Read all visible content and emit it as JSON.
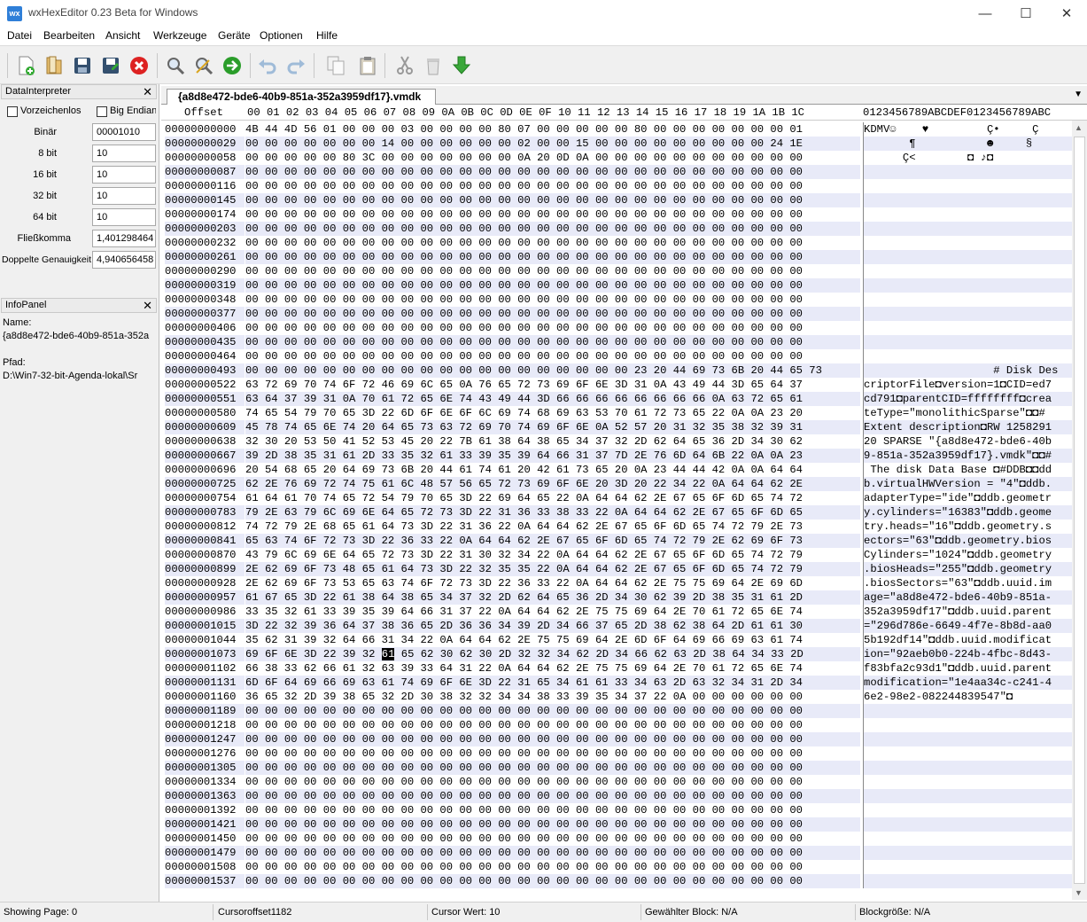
{
  "window": {
    "title": "wxHexEditor 0.23 Beta for Windows",
    "app_icon_text": "wx",
    "minimize": "—",
    "maximize": "☐",
    "close": "✕"
  },
  "menu": [
    "Datei",
    "Bearbeiten",
    "Ansicht",
    "Werkzeuge",
    "Geräte",
    "Optionen",
    "Hilfe"
  ],
  "toolbar": {
    "icons": [
      "new-file-icon",
      "open-file-icon",
      "save-icon",
      "save-as-icon",
      "close-file-icon",
      "find-icon",
      "find-replace-icon",
      "goto-icon",
      "undo-icon",
      "redo-icon",
      "copy-icon",
      "paste-icon",
      "cut-icon",
      "delete-icon",
      "insert-icon"
    ]
  },
  "datainterpreter": {
    "title": "DataInterpreter",
    "signed_label": "Vorzeichenlos",
    "bigendian_label": "Big Endian",
    "fields": [
      {
        "label": "Binär",
        "value": "00001010"
      },
      {
        "label": "8 bit",
        "value": "10"
      },
      {
        "label": "16 bit",
        "value": "10"
      },
      {
        "label": "32 bit",
        "value": "10"
      },
      {
        "label": "64 bit",
        "value": "10"
      },
      {
        "label": "Fließkomma",
        "value": "1,401298464"
      },
      {
        "label": "Doppelte Genauigkeit",
        "value": "4,940656458"
      }
    ]
  },
  "infopanel": {
    "title": "InfoPanel",
    "name_label": "Name:",
    "name_value": "{a8d8e472-bde6-40b9-851a-352a",
    "path_label": "Pfad:",
    "path_value": "D:\\Win7-32-bit-Agenda-lokal\\Sr"
  },
  "tab": {
    "label": "{a8d8e472-bde6-40b9-851a-352a3959df17}.vmdk"
  },
  "hex": {
    "header_offset": "Offset",
    "header_bytes": "00 01 02 03 04 05 06 07 08 09 0A 0B 0C 0D 0E 0F 10 11 12 13 14 15 16 17 18 19 1A 1B 1C",
    "header_text": "0123456789ABCDEF0123456789ABC",
    "rows": [
      [
        "00000000000",
        "4B 44 4D 56 01 00 00 00 03 00 00 00 00 80 07 00 00 00 00 00 80 00 00 00 00 00 00 00 01",
        "KDMV☺    ♥         Ç•     Ç       ☺"
      ],
      [
        "00000000029",
        "00 00 00 00 00 00 00 14 00 00 00 00 00 00 02 00 00 15 00 00 00 00 00 00 00 00 00 24 1E",
        "       ¶           ☻     §         $▲"
      ],
      [
        "00000000058",
        "00 00 00 00 00 80 3C 00 00 00 00 00 00 00 0A 20 0D 0A 00 00 00 00 00 00 00 00 00 00 00",
        "      Ç<        ◘ ♪◘"
      ],
      [
        "00000000087",
        "00 00 00 00 00 00 00 00 00 00 00 00 00 00 00 00 00 00 00 00 00 00 00 00 00 00 00 00 00",
        ""
      ],
      [
        "00000000116",
        "00 00 00 00 00 00 00 00 00 00 00 00 00 00 00 00 00 00 00 00 00 00 00 00 00 00 00 00 00",
        ""
      ],
      [
        "00000000145",
        "00 00 00 00 00 00 00 00 00 00 00 00 00 00 00 00 00 00 00 00 00 00 00 00 00 00 00 00 00",
        ""
      ],
      [
        "00000000174",
        "00 00 00 00 00 00 00 00 00 00 00 00 00 00 00 00 00 00 00 00 00 00 00 00 00 00 00 00 00",
        ""
      ],
      [
        "00000000203",
        "00 00 00 00 00 00 00 00 00 00 00 00 00 00 00 00 00 00 00 00 00 00 00 00 00 00 00 00 00",
        ""
      ],
      [
        "00000000232",
        "00 00 00 00 00 00 00 00 00 00 00 00 00 00 00 00 00 00 00 00 00 00 00 00 00 00 00 00 00",
        ""
      ],
      [
        "00000000261",
        "00 00 00 00 00 00 00 00 00 00 00 00 00 00 00 00 00 00 00 00 00 00 00 00 00 00 00 00 00",
        ""
      ],
      [
        "00000000290",
        "00 00 00 00 00 00 00 00 00 00 00 00 00 00 00 00 00 00 00 00 00 00 00 00 00 00 00 00 00",
        ""
      ],
      [
        "00000000319",
        "00 00 00 00 00 00 00 00 00 00 00 00 00 00 00 00 00 00 00 00 00 00 00 00 00 00 00 00 00",
        ""
      ],
      [
        "00000000348",
        "00 00 00 00 00 00 00 00 00 00 00 00 00 00 00 00 00 00 00 00 00 00 00 00 00 00 00 00 00",
        ""
      ],
      [
        "00000000377",
        "00 00 00 00 00 00 00 00 00 00 00 00 00 00 00 00 00 00 00 00 00 00 00 00 00 00 00 00 00",
        ""
      ],
      [
        "00000000406",
        "00 00 00 00 00 00 00 00 00 00 00 00 00 00 00 00 00 00 00 00 00 00 00 00 00 00 00 00 00",
        ""
      ],
      [
        "00000000435",
        "00 00 00 00 00 00 00 00 00 00 00 00 00 00 00 00 00 00 00 00 00 00 00 00 00 00 00 00 00",
        ""
      ],
      [
        "00000000464",
        "00 00 00 00 00 00 00 00 00 00 00 00 00 00 00 00 00 00 00 00 00 00 00 00 00 00 00 00 00",
        ""
      ],
      [
        "00000000493",
        "00 00 00 00 00 00 00 00 00 00 00 00 00 00 00 00 00 00 00 00 23 20 44 69 73 6B 20 44 65 73",
        "                    # Disk Des"
      ],
      [
        "00000000522",
        "63 72 69 70 74 6F 72 46 69 6C 65 0A 76 65 72 73 69 6F 6E 3D 31 0A 43 49 44 3D 65 64 37",
        "criptorFile◘version=1◘CID=ed7"
      ],
      [
        "00000000551",
        "63 64 37 39 31 0A 70 61 72 65 6E 74 43 49 44 3D 66 66 66 66 66 66 66 66 0A 63 72 65 61",
        "cd791◘parentCID=ffffffff◘crea"
      ],
      [
        "00000000580",
        "74 65 54 79 70 65 3D 22 6D 6F 6E 6F 6C 69 74 68 69 63 53 70 61 72 73 65 22 0A 0A 23 20",
        "teType=\"monolithicSparse\"◘◘# "
      ],
      [
        "00000000609",
        "45 78 74 65 6E 74 20 64 65 73 63 72 69 70 74 69 6F 6E 0A 52 57 20 31 32 35 38 32 39 31",
        "Extent description◘RW 1258291"
      ],
      [
        "00000000638",
        "32 30 20 53 50 41 52 53 45 20 22 7B 61 38 64 38 65 34 37 32 2D 62 64 65 36 2D 34 30 62",
        "20 SPARSE \"{a8d8e472-bde6-40b"
      ],
      [
        "00000000667",
        "39 2D 38 35 31 61 2D 33 35 32 61 33 39 35 39 64 66 31 37 7D 2E 76 6D 64 6B 22 0A 0A 23",
        "9-851a-352a3959df17}.vmdk\"◘◘#"
      ],
      [
        "00000000696",
        "20 54 68 65 20 64 69 73 6B 20 44 61 74 61 20 42 61 73 65 20 0A 23 44 44 42 0A 0A 64 64",
        " The disk Data Base ◘#DDB◘◘dd"
      ],
      [
        "00000000725",
        "62 2E 76 69 72 74 75 61 6C 48 57 56 65 72 73 69 6F 6E 20 3D 20 22 34 22 0A 64 64 62 2E",
        "b.virtualHWVersion = \"4\"◘ddb."
      ],
      [
        "00000000754",
        "61 64 61 70 74 65 72 54 79 70 65 3D 22 69 64 65 22 0A 64 64 62 2E 67 65 6F 6D 65 74 72",
        "adapterType=\"ide\"◘ddb.geometr"
      ],
      [
        "00000000783",
        "79 2E 63 79 6C 69 6E 64 65 72 73 3D 22 31 36 33 38 33 22 0A 64 64 62 2E 67 65 6F 6D 65",
        "y.cylinders=\"16383\"◘ddb.geome"
      ],
      [
        "00000000812",
        "74 72 79 2E 68 65 61 64 73 3D 22 31 36 22 0A 64 64 62 2E 67 65 6F 6D 65 74 72 79 2E 73",
        "try.heads=\"16\"◘ddb.geometry.s"
      ],
      [
        "00000000841",
        "65 63 74 6F 72 73 3D 22 36 33 22 0A 64 64 62 2E 67 65 6F 6D 65 74 72 79 2E 62 69 6F 73",
        "ectors=\"63\"◘ddb.geometry.bios"
      ],
      [
        "00000000870",
        "43 79 6C 69 6E 64 65 72 73 3D 22 31 30 32 34 22 0A 64 64 62 2E 67 65 6F 6D 65 74 72 79",
        "Cylinders=\"1024\"◘ddb.geometry"
      ],
      [
        "00000000899",
        "2E 62 69 6F 73 48 65 61 64 73 3D 22 32 35 35 22 0A 64 64 62 2E 67 65 6F 6D 65 74 72 79",
        ".biosHeads=\"255\"◘ddb.geometry"
      ],
      [
        "00000000928",
        "2E 62 69 6F 73 53 65 63 74 6F 72 73 3D 22 36 33 22 0A 64 64 62 2E 75 75 69 64 2E 69 6D",
        ".biosSectors=\"63\"◘ddb.uuid.im"
      ],
      [
        "00000000957",
        "61 67 65 3D 22 61 38 64 38 65 34 37 32 2D 62 64 65 36 2D 34 30 62 39 2D 38 35 31 61 2D",
        "age=\"a8d8e472-bde6-40b9-851a-"
      ],
      [
        "00000000986",
        "33 35 32 61 33 39 35 39 64 66 31 37 22 0A 64 64 62 2E 75 75 69 64 2E 70 61 72 65 6E 74",
        "352a3959df17\"◘ddb.uuid.parent"
      ],
      [
        "00000001015",
        "3D 22 32 39 36 64 37 38 36 65 2D 36 36 34 39 2D 34 66 37 65 2D 38 62 38 64 2D 61 61 30",
        "=\"296d786e-6649-4f7e-8b8d-aa0"
      ],
      [
        "00000001044",
        "35 62 31 39 32 64 66 31 34 22 0A 64 64 62 2E 75 75 69 64 2E 6D 6F 64 69 66 69 63 61 74",
        "5b192df14\"◘ddb.uuid.modificat"
      ],
      [
        "00000001073",
        "69 6F 6E 3D 22 39 32 61 65 62 30 62 30 2D 32 32 34 62 2D 34 66 62 63 2D 38 64 34 33 2D",
        "ion=\"92aeb0b0-224b-4fbc-8d43-"
      ],
      [
        "00000001102",
        "66 38 33 62 66 61 32 63 39 33 64 31 22 0A 64 64 62 2E 75 75 69 64 2E 70 61 72 65 6E 74",
        "f83bfa2c93d1\"◘ddb.uuid.parent"
      ],
      [
        "00000001131",
        "6D 6F 64 69 66 69 63 61 74 69 6F 6E 3D 22 31 65 34 61 61 33 34 63 2D 63 32 34 31 2D 34",
        "modification=\"1e4aa34c-c241-4"
      ],
      [
        "00000001160",
        "36 65 32 2D 39 38 65 32 2D 30 38 32 32 34 34 38 33 39 35 34 37 22 0A 00 00 00 00 00 00",
        "6e2-98e2-082244839547\"◘"
      ],
      [
        "00000001189",
        "00 00 00 00 00 00 00 00 00 00 00 00 00 00 00 00 00 00 00 00 00 00 00 00 00 00 00 00 00",
        ""
      ],
      [
        "00000001218",
        "00 00 00 00 00 00 00 00 00 00 00 00 00 00 00 00 00 00 00 00 00 00 00 00 00 00 00 00 00",
        ""
      ],
      [
        "00000001247",
        "00 00 00 00 00 00 00 00 00 00 00 00 00 00 00 00 00 00 00 00 00 00 00 00 00 00 00 00 00",
        ""
      ],
      [
        "00000001276",
        "00 00 00 00 00 00 00 00 00 00 00 00 00 00 00 00 00 00 00 00 00 00 00 00 00 00 00 00 00",
        ""
      ],
      [
        "00000001305",
        "00 00 00 00 00 00 00 00 00 00 00 00 00 00 00 00 00 00 00 00 00 00 00 00 00 00 00 00 00",
        ""
      ],
      [
        "00000001334",
        "00 00 00 00 00 00 00 00 00 00 00 00 00 00 00 00 00 00 00 00 00 00 00 00 00 00 00 00 00",
        ""
      ],
      [
        "00000001363",
        "00 00 00 00 00 00 00 00 00 00 00 00 00 00 00 00 00 00 00 00 00 00 00 00 00 00 00 00 00",
        ""
      ],
      [
        "00000001392",
        "00 00 00 00 00 00 00 00 00 00 00 00 00 00 00 00 00 00 00 00 00 00 00 00 00 00 00 00 00",
        ""
      ],
      [
        "00000001421",
        "00 00 00 00 00 00 00 00 00 00 00 00 00 00 00 00 00 00 00 00 00 00 00 00 00 00 00 00 00",
        ""
      ],
      [
        "00000001450",
        "00 00 00 00 00 00 00 00 00 00 00 00 00 00 00 00 00 00 00 00 00 00 00 00 00 00 00 00 00",
        ""
      ],
      [
        "00000001479",
        "00 00 00 00 00 00 00 00 00 00 00 00 00 00 00 00 00 00 00 00 00 00 00 00 00 00 00 00 00",
        ""
      ],
      [
        "00000001508",
        "00 00 00 00 00 00 00 00 00 00 00 00 00 00 00 00 00 00 00 00 00 00 00 00 00 00 00 00 00",
        ""
      ],
      [
        "00000001537",
        "00 00 00 00 00 00 00 00 00 00 00 00 00 00 00 00 00 00 00 00 00 00 00 00 00 00 00 00 00",
        ""
      ]
    ]
  },
  "status": {
    "page": "Showing Page: 0",
    "cursor_offset": "Cursoroffset1182",
    "cursor_value": "Cursor Wert: 10",
    "selected_block": "Gewählter Block: N/A",
    "block_size": "Blockgröße: N/A"
  },
  "colors": {
    "row_alt": "#e8eaf8",
    "selection": "#000000"
  }
}
